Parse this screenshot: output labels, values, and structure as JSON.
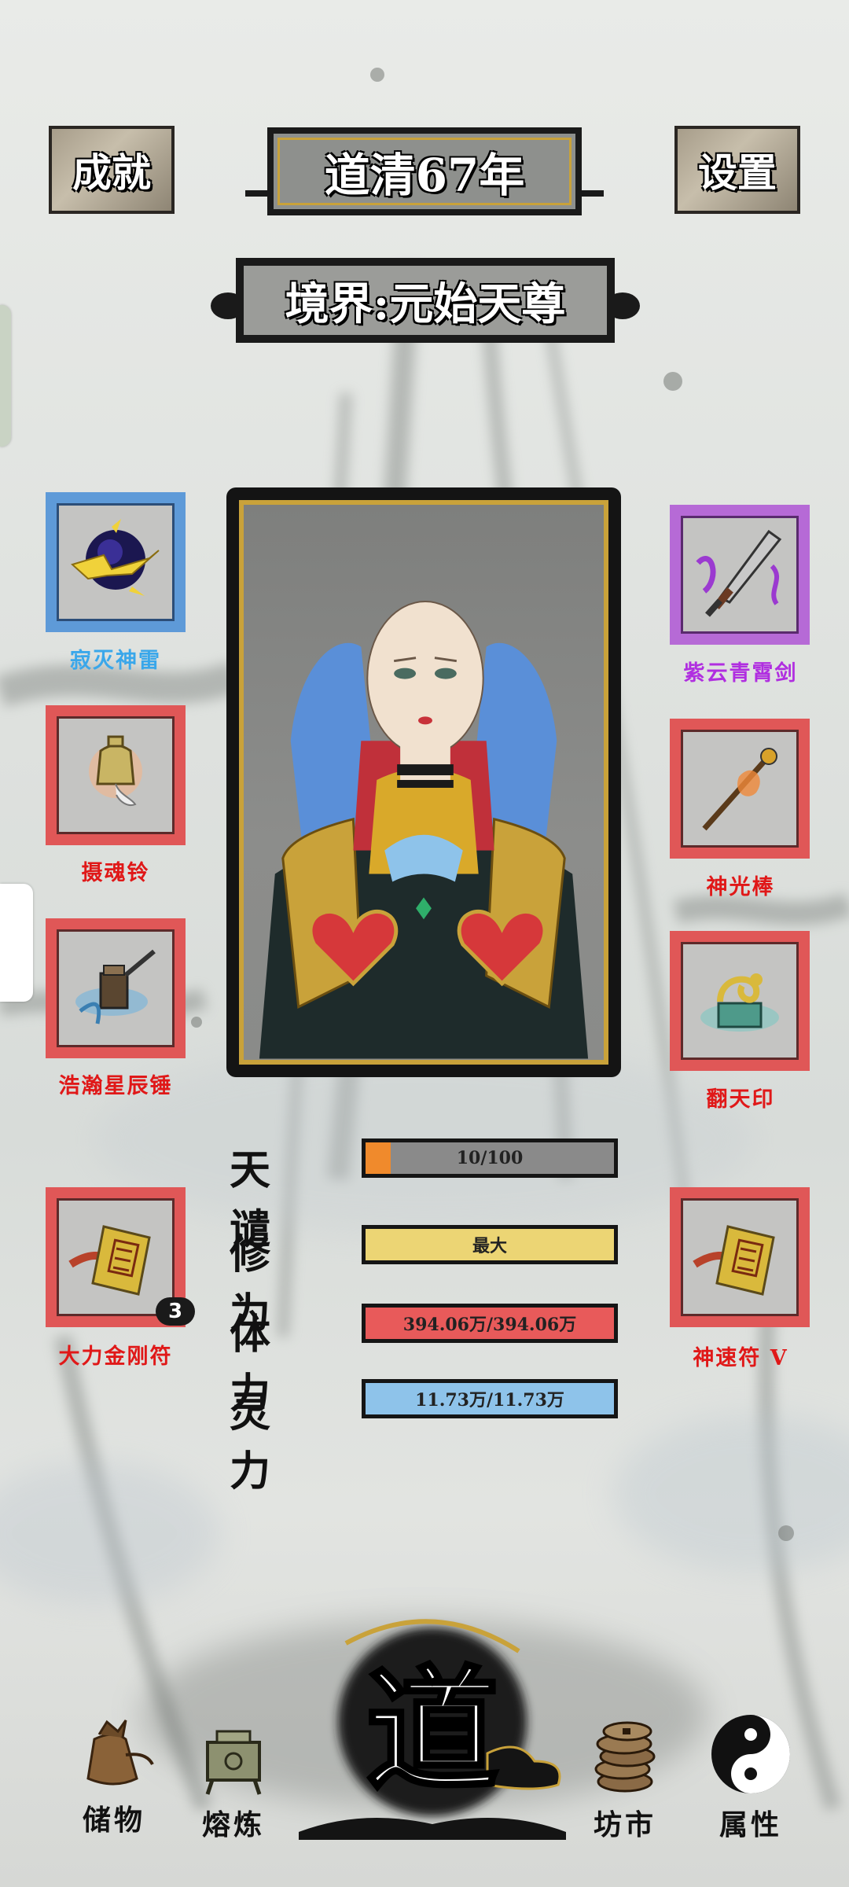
{
  "header": {
    "achievements_label": "成就",
    "year_label": "道清67年",
    "settings_label": "设置",
    "realm_label": "境界:元始天尊"
  },
  "equipment": {
    "left": [
      {
        "name": "寂灭神雷",
        "rarity_color": "#3aa7ea",
        "icon": "thunder-orb-icon"
      },
      {
        "name": "摄魂铃",
        "rarity_color": "#e01818",
        "icon": "soul-bell-icon"
      },
      {
        "name": "浩瀚星辰锤",
        "rarity_color": "#e01818",
        "icon": "star-hammer-icon"
      },
      {
        "name": "大力金刚符",
        "rarity_color": "#e01818",
        "icon": "talisman-icon",
        "count": "3"
      }
    ],
    "right": [
      {
        "name": "紫云青霄剑",
        "rarity_color": "#b02ee0",
        "icon": "sword-icon"
      },
      {
        "name": "神光棒",
        "rarity_color": "#e01818",
        "icon": "staff-icon"
      },
      {
        "name": "翻天印",
        "rarity_color": "#e01818",
        "icon": "dragon-seal-icon"
      },
      {
        "name": "神速符 V",
        "rarity_color": "#e01818",
        "icon": "talisman-icon"
      }
    ]
  },
  "stats": [
    {
      "label": "天谴",
      "value": "10/100",
      "fill": 0.1,
      "fill_color": "#f08a2c",
      "track_color": "#8a8a8a"
    },
    {
      "label": "修为",
      "value": "最大",
      "fill": 1.0,
      "fill_color": "#ecd574",
      "track_color": "#ecd574"
    },
    {
      "label": "体力",
      "value": "394.06万/394.06万",
      "fill": 1.0,
      "fill_color": "#e85a5a",
      "track_color": "#e85a5a"
    },
    {
      "label": "灵力",
      "value": "11.73万/11.73万",
      "fill": 1.0,
      "fill_color": "#8ec3ea",
      "track_color": "#8ec3ea"
    }
  ],
  "bottom_nav": {
    "storage": "储物",
    "smelt": "熔炼",
    "dao": "道",
    "market": "坊市",
    "attributes": "属性"
  }
}
